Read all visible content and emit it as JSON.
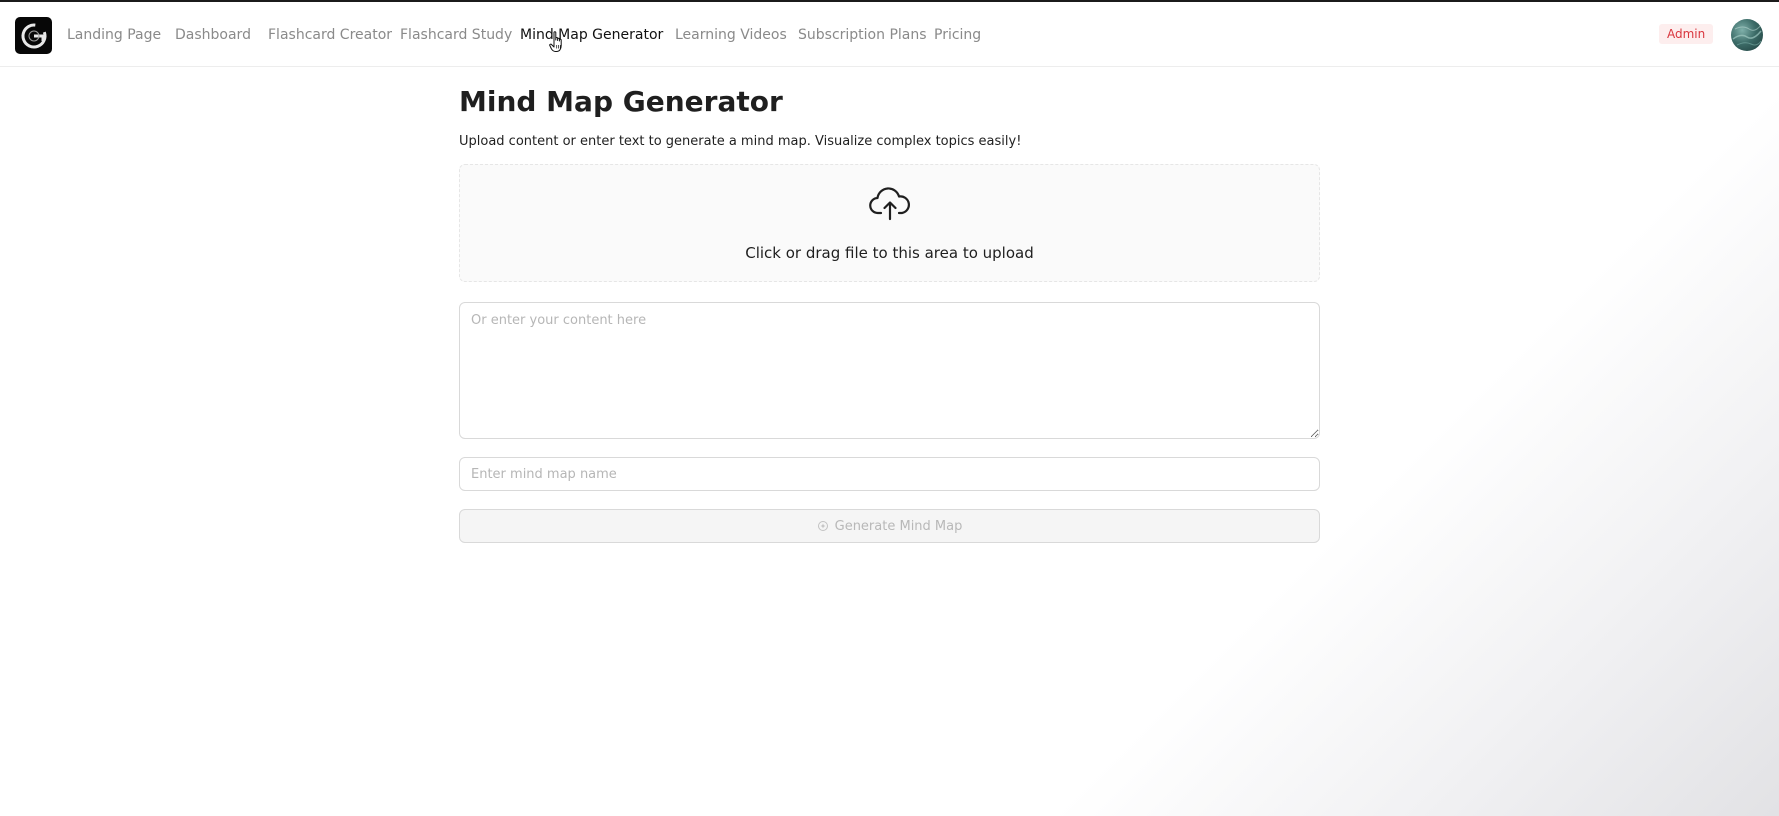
{
  "nav": {
    "logo_icon": "brand-logo-icon",
    "items": [
      {
        "label": "Landing Page",
        "active": false
      },
      {
        "label": "Dashboard",
        "active": false
      },
      {
        "label": "Flashcard Creator",
        "active": false
      },
      {
        "label": "Flashcard Study",
        "active": false
      },
      {
        "label": "Mind Map Generator",
        "active": true
      },
      {
        "label": "Learning Videos",
        "active": false
      },
      {
        "label": "Subscription Plans",
        "active": false
      },
      {
        "label": "Pricing",
        "active": false
      }
    ],
    "admin_badge": "Admin",
    "avatar_icon": "user-avatar"
  },
  "page": {
    "title": "Mind Map Generator",
    "subtitle": "Upload content or enter text to generate a mind map. Visualize complex topics easily!"
  },
  "upload": {
    "icon": "cloud-upload-icon",
    "text": "Click or drag file to this area to upload"
  },
  "content_input": {
    "placeholder": "Or enter your content here",
    "value": ""
  },
  "name_input": {
    "placeholder": "Enter mind map name",
    "value": ""
  },
  "generate_button": {
    "icon": "sparkle-icon",
    "label": "Generate Mind Map",
    "disabled": true
  },
  "colors": {
    "active_nav": "#111111",
    "inactive_nav": "#8a8a8a",
    "admin_badge_bg": "#fdeeee",
    "admin_badge_text": "#d9363e",
    "disabled_button_bg": "#f5f5f5"
  }
}
